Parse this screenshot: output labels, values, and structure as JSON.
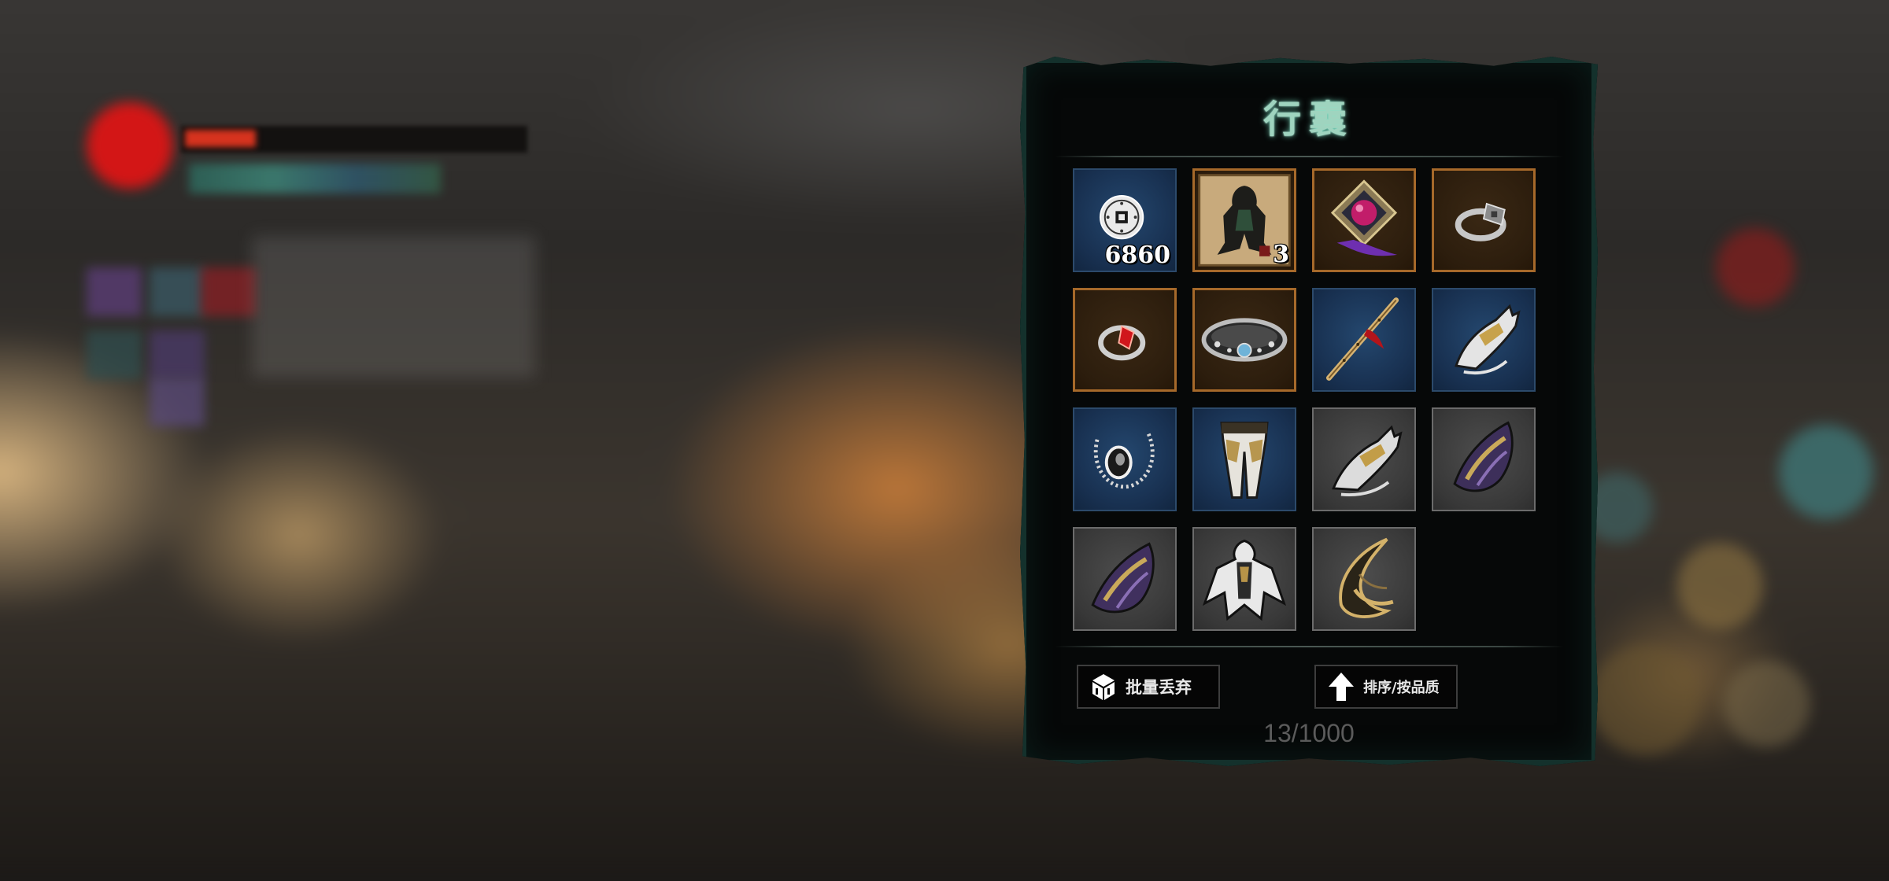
{
  "inventory": {
    "title": "行囊",
    "capacity": "13/1000",
    "buttons": {
      "batch_discard": "批量丢弃",
      "sort": "排序/按品质"
    },
    "items": [
      {
        "name": "copper-coin",
        "rarity": "blue",
        "count": "6860"
      },
      {
        "name": "cloak-scroll",
        "rarity": "gold",
        "count": "3"
      },
      {
        "name": "amethyst-amulet",
        "rarity": "gold",
        "count": ""
      },
      {
        "name": "silver-ring",
        "rarity": "gold",
        "count": ""
      },
      {
        "name": "ruby-ring",
        "rarity": "gold",
        "count": ""
      },
      {
        "name": "studded-belt",
        "rarity": "gold",
        "count": ""
      },
      {
        "name": "red-tassel-flute",
        "rarity": "blue",
        "count": ""
      },
      {
        "name": "clawed-gauntlet",
        "rarity": "blue",
        "count": ""
      },
      {
        "name": "bead-necklace",
        "rarity": "blue",
        "count": ""
      },
      {
        "name": "armored-leggings",
        "rarity": "blue",
        "count": ""
      },
      {
        "name": "clawed-gauntlet",
        "rarity": "grey",
        "count": ""
      },
      {
        "name": "purple-bracer",
        "rarity": "grey",
        "count": ""
      },
      {
        "name": "purple-bracer",
        "rarity": "grey",
        "count": ""
      },
      {
        "name": "feathered-robe",
        "rarity": "grey",
        "count": ""
      },
      {
        "name": "horn-blade",
        "rarity": "grey",
        "count": ""
      }
    ]
  },
  "colors": {
    "blue_slot": "#1d3b5e",
    "gold_border": "#a6692a",
    "grey_slot": "#3e3e3e",
    "title_glow": "#9fd4bf",
    "panel_border": "#14312c"
  }
}
